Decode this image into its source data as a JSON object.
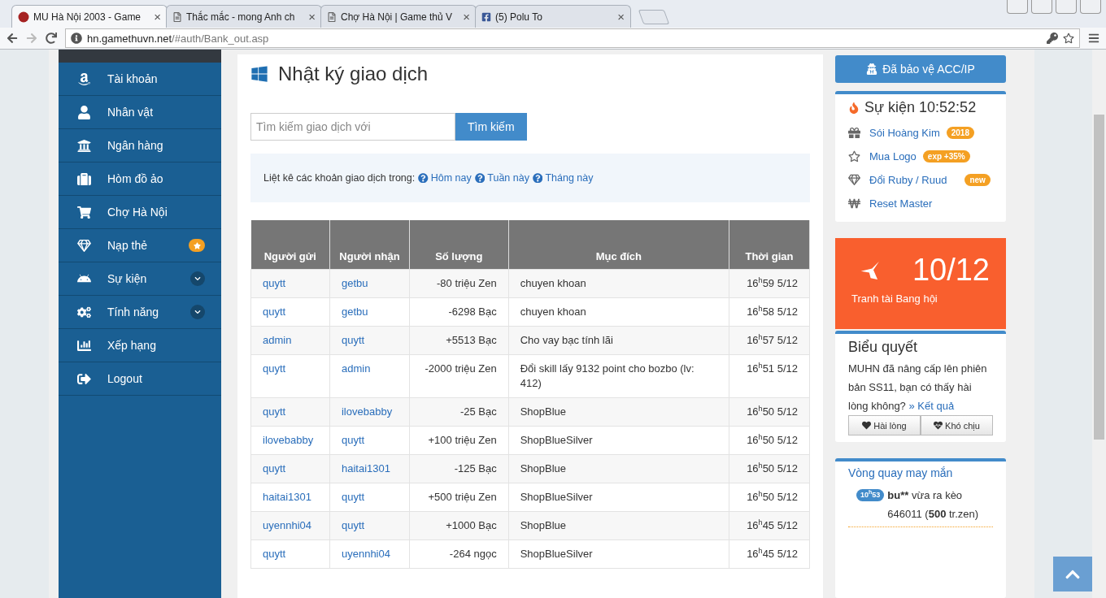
{
  "browser": {
    "tabs": [
      {
        "title": "MU Hà Nội 2003 - Game",
        "selected": true
      },
      {
        "title": "Thắc mắc - mong Anh ch",
        "selected": false
      },
      {
        "title": "Chợ Hà Nội | Game thủ V",
        "selected": false
      },
      {
        "title": "(5) Polu To",
        "selected": false
      }
    ],
    "close_glyph": "×",
    "url_domain": "hn.gamethuvn.net",
    "url_path": "/#auth/Bank_out.asp"
  },
  "sidebar": {
    "items": [
      {
        "label": "Tài khoản",
        "kind": "plain"
      },
      {
        "label": "Nhân vật",
        "kind": "plain"
      },
      {
        "label": "Ngân hàng",
        "kind": "plain"
      },
      {
        "label": "Hòm đồ ảo",
        "kind": "plain"
      },
      {
        "label": "Chợ Hà Nội",
        "kind": "plain"
      },
      {
        "label": "Nạp thẻ",
        "kind": "starred"
      },
      {
        "label": "Sự kiện",
        "kind": "submenu"
      },
      {
        "label": "Tính năng",
        "kind": "submenu"
      },
      {
        "label": "Xếp hạng",
        "kind": "plain"
      },
      {
        "label": "Logout",
        "kind": "plain"
      }
    ]
  },
  "main": {
    "title": "Nhật ký giao dịch",
    "search": {
      "placeholder": "Tìm kiếm giao dịch với",
      "button": "Tìm kiếm"
    },
    "filter": {
      "label": "Liệt kê các khoản giao dịch trong:",
      "links": [
        "Hôm nay",
        "Tuần này",
        "Tháng này"
      ]
    },
    "table": {
      "columns": [
        "Người gửi",
        "Người nhận",
        "Số lượng",
        "Mục đích",
        "Thời gian"
      ],
      "rows": [
        [
          "quytt",
          "getbu",
          "-80 triệu Zen",
          "chuyen khoan",
          "16$^{h}$59 5/12"
        ],
        [
          "quytt",
          "getbu",
          "-6298 Bạc",
          "chuyen khoan",
          "16$^{h}$58 5/12"
        ],
        [
          "admin",
          "quytt",
          "+5513 Bạc",
          "Cho vay bạc tính lãi",
          "16$^{h}$57 5/12"
        ],
        [
          "quytt",
          "admin",
          "-2000 triệu Zen",
          "Đổi skill lấy 9132 point cho bozbo (lv: 412)",
          "16$^{h}$51 5/12"
        ],
        [
          "quytt",
          "ilovebabby",
          "-25 Bạc",
          "ShopBlue",
          "16$^{h}$50 5/12"
        ],
        [
          "ilovebabby",
          "quytt",
          "+100 triệu Zen",
          "ShopBlueSilver",
          "16$^{h}$50 5/12"
        ],
        [
          "quytt",
          "haitai1301",
          "-125 Bạc",
          "ShopBlue",
          "16$^{h}$50 5/12"
        ],
        [
          "haitai1301",
          "quytt",
          "+500 triệu Zen",
          "ShopBlueSilver",
          "16$^{h}$50 5/12"
        ],
        [
          "uyennhi04",
          "quytt",
          "+1000 Bạc",
          "ShopBlue",
          "16$^{h}$45 5/12"
        ],
        [
          "quytt",
          "uyennhi04",
          "-264 ngọc",
          "ShopBlueSilver",
          "16$^{h}$45 5/12"
        ]
      ]
    }
  },
  "right": {
    "protect_button": "Đã bảo vệ ACC/IP",
    "events": {
      "title": "Sự kiện 10:52:52",
      "items": [
        {
          "label": "Sói Hoàng Kim",
          "tag": "2018"
        },
        {
          "label": "Mua Logo",
          "tag": "exp +35%"
        },
        {
          "label": "Đổi Ruby / Ruud",
          "tag": "new"
        },
        {
          "label": "Reset Master"
        }
      ]
    },
    "guild": {
      "count": "10/12",
      "label": "Tranh tài Bang hội"
    },
    "poll": {
      "title": "Biểu quyết",
      "question": "MUHN đã nâng cấp lên phiên bản SS11, bạn có thấy hài lòng không?",
      "result_link": "» Kết quả",
      "buttons": [
        "Hài lòng",
        "Khó chịu"
      ]
    },
    "wheel": {
      "title": "Vòng quay may mắn",
      "time": "10$^{h}$53",
      "user": "bu**",
      "text": "vừa ra kèo 646011 (**500** tr.zen)"
    }
  }
}
